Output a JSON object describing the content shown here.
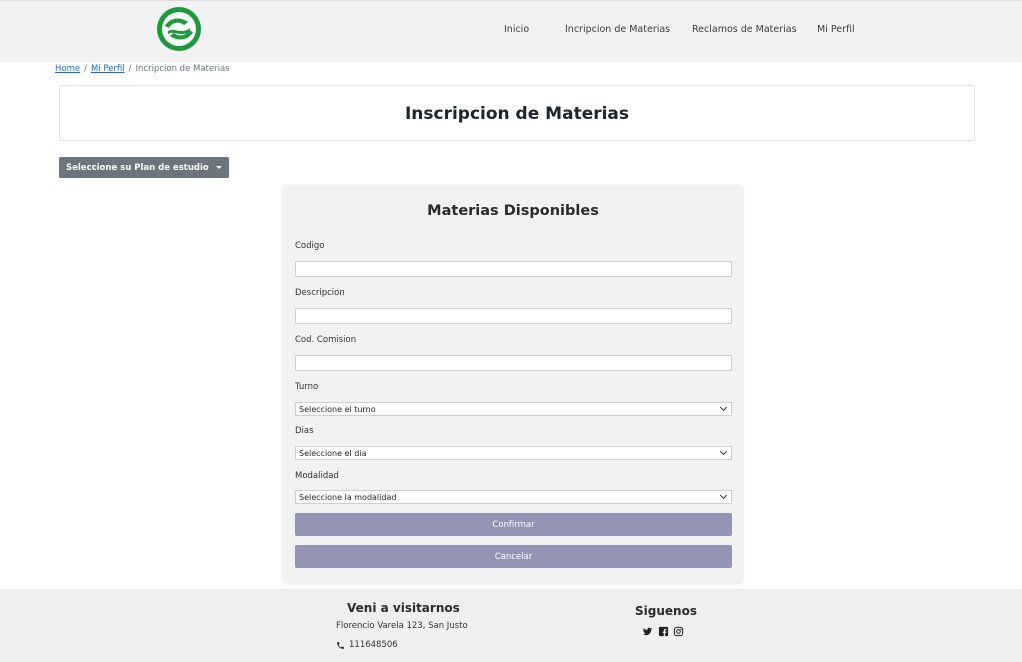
{
  "nav": {
    "items": [
      "Inicio",
      "Incripcion de Materias",
      "Reclamos de Materias",
      "Mi Perfil"
    ]
  },
  "breadcrumb": {
    "home": "Home",
    "profile": "Mi Perfil",
    "current": "Incripcion de Materias",
    "separator": "/"
  },
  "page": {
    "title": "Inscripcion de Materias",
    "plan_button": "Seleccione su Plan de estudio"
  },
  "form": {
    "title": "Materias Disponibles",
    "codigo_label": "Codigo",
    "codigo_value": "",
    "descripcion_label": "Descripcion",
    "descripcion_value": "",
    "comision_label": "Cod. Comision",
    "comision_value": "",
    "turno_label": "Turno",
    "turno_selected": "Seleccione el turno",
    "dias_label": "Dias",
    "dias_selected": "Seleccione el dia",
    "modalidad_label": "Modalidad",
    "modalidad_selected": "Seleccione la modalidad",
    "confirm_label": "Confirmar",
    "cancel_label": "Cancelar"
  },
  "footer": {
    "visit_title": "Veni a visitarnos",
    "address": "Florencio Varela 123, San Justo",
    "phone": "111648506",
    "follow_title": "Siguenos"
  },
  "icons": {
    "logo": "university-logo",
    "phone": "phone-icon",
    "social": [
      "twitter-icon",
      "facebook-icon",
      "instagram-icon"
    ]
  },
  "colors": {
    "brand_green": "#1a9b3c",
    "navbar_bg": "#f2f2f2",
    "primary_button": "#9393b3",
    "secondary_button": "#6c757d",
    "link": "#0d6efd"
  }
}
